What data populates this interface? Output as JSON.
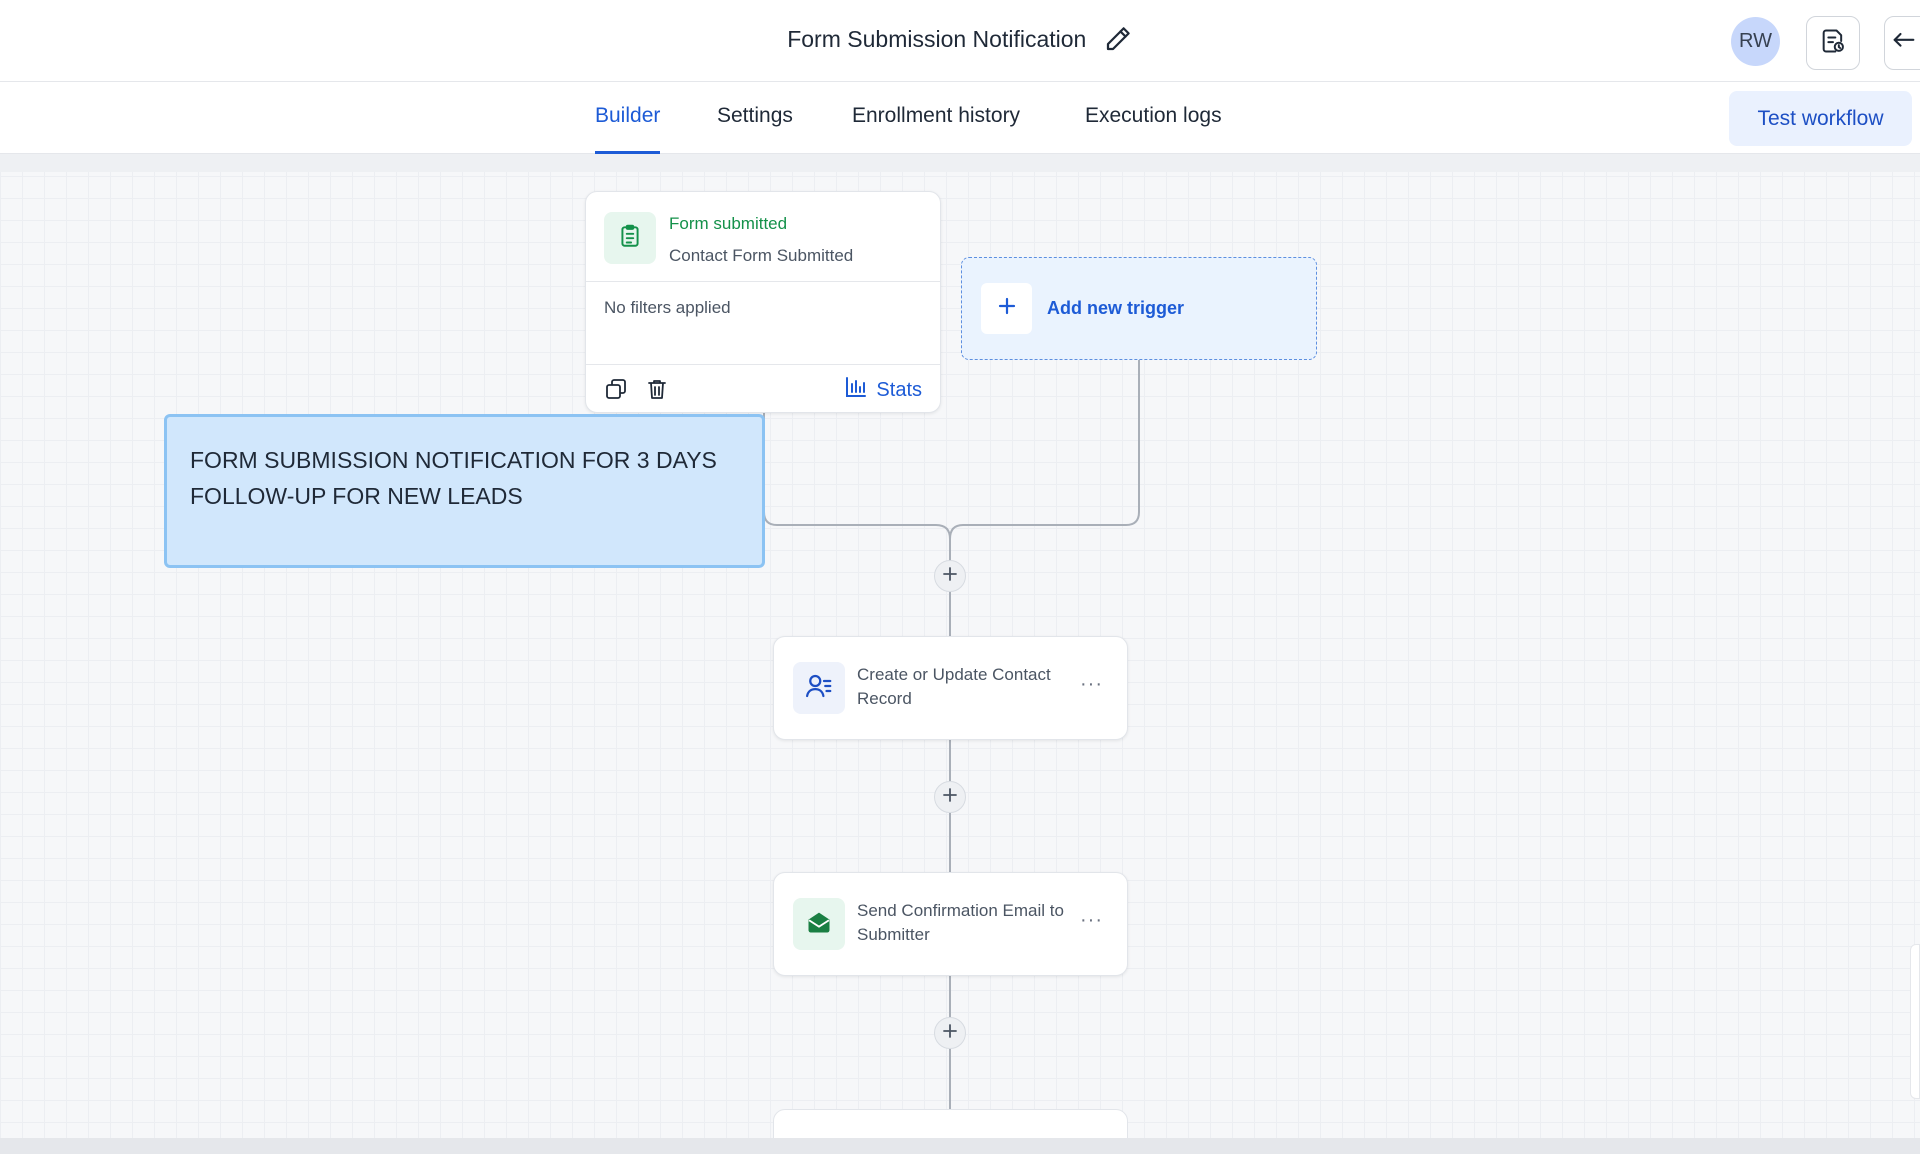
{
  "header": {
    "workflow_title": "Form Submission Notification",
    "user_initials": "RW"
  },
  "tabs": [
    {
      "label": "Builder",
      "active": true
    },
    {
      "label": "Settings",
      "active": false
    },
    {
      "label": "Enrollment history",
      "active": false
    },
    {
      "label": "Execution logs",
      "active": false
    }
  ],
  "toolbar": {
    "test_label": "Test workflow"
  },
  "trigger": {
    "name": "Form submitted",
    "subtitle": "Contact Form Submitted",
    "filters": "No filters applied",
    "stats_label": "Stats"
  },
  "add_trigger": {
    "label": "Add new trigger"
  },
  "note": {
    "text": "FORM SUBMISSION NOTIFICATION FOR 3 DAYS FOLLOW-UP FOR NEW LEADS"
  },
  "actions": [
    {
      "label": "Create or Update Contact Record",
      "icon": "contact-list-icon"
    },
    {
      "label": "Send Confirmation Email to Submitter",
      "icon": "email-icon"
    }
  ],
  "colors": {
    "accent": "#1d5bd6",
    "trigger_green": "#14914a",
    "note_background": "#d1e7fc",
    "email_green": "#1a7f43"
  }
}
